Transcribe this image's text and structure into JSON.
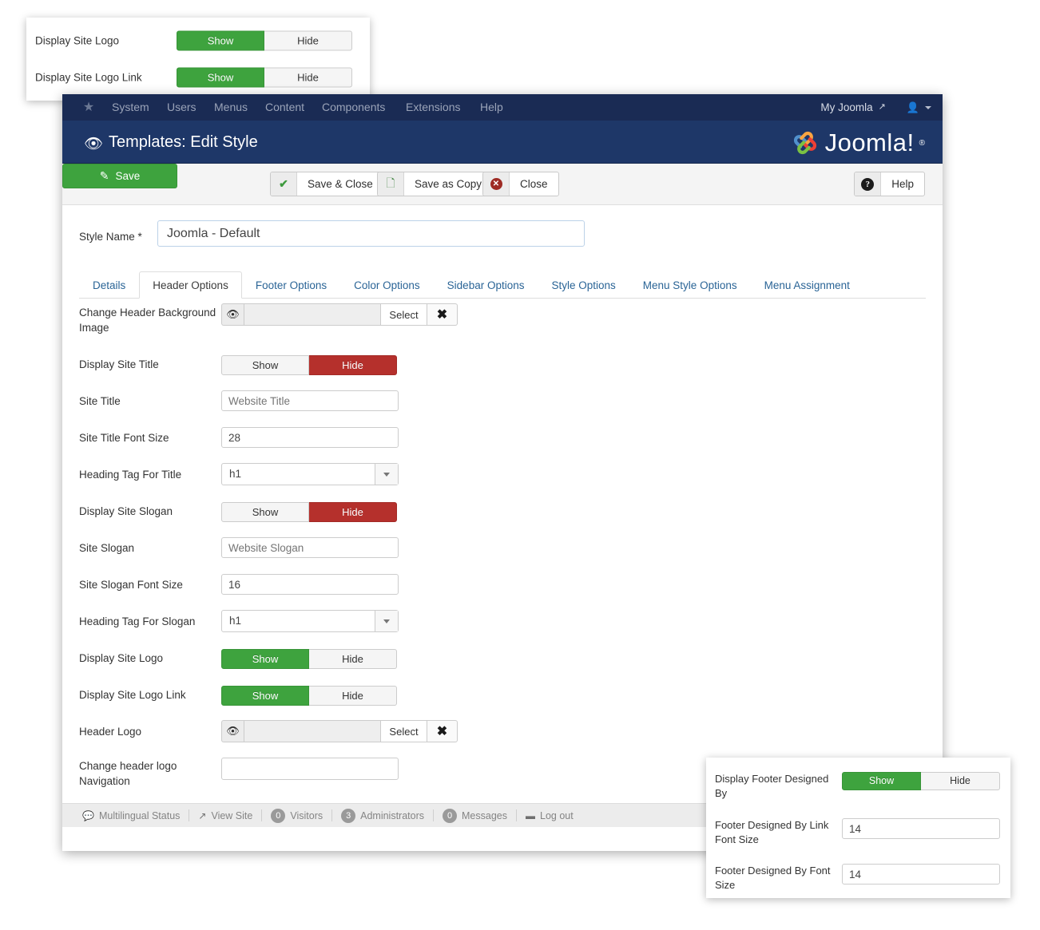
{
  "top_panel": {
    "rows": [
      {
        "label": "Display Site Logo",
        "options": [
          "Show",
          "Hide"
        ],
        "selected": "Show"
      },
      {
        "label": "Display Site Logo Link",
        "options": [
          "Show",
          "Hide"
        ],
        "selected": "Show"
      }
    ]
  },
  "topbar": {
    "brand_icon": "joomla-mark-icon",
    "menu": [
      "System",
      "Users",
      "Menus",
      "Content",
      "Components",
      "Extensions",
      "Help"
    ],
    "site_name": "My Joomla",
    "external_icon": "external-link-icon",
    "user_icon": "user-icon"
  },
  "header": {
    "icon": "eye-icon",
    "title": "Templates: Edit Style",
    "logo_text": "Joomla!",
    "logo_reg": "®"
  },
  "toolbar": {
    "save_label": "Save",
    "save_icon": "pencil-square-icon",
    "save_close_label": "Save & Close",
    "save_close_icon": "check-icon",
    "save_copy_label": "Save as Copy",
    "save_copy_icon": "copy-icon",
    "close_label": "Close",
    "close_icon": "circle-x-icon",
    "help_label": "Help",
    "help_icon": "circle-question-icon"
  },
  "form": {
    "style_name_label": "Style Name *",
    "style_name_value": "Joomla - Default"
  },
  "tabs": [
    {
      "label": "Details",
      "active": false
    },
    {
      "label": "Header Options",
      "active": true
    },
    {
      "label": "Footer Options",
      "active": false
    },
    {
      "label": "Color Options",
      "active": false
    },
    {
      "label": "Sidebar Options",
      "active": false
    },
    {
      "label": "Style Options",
      "active": false
    },
    {
      "label": "Menu Style Options",
      "active": false
    },
    {
      "label": "Menu Assignment",
      "active": false
    }
  ],
  "fields": [
    {
      "label": "Change Header Background Image",
      "type": "media",
      "value": "",
      "eye_icon": "eye-icon",
      "select_label": "Select",
      "clear_icon": "clear-x-icon"
    },
    {
      "label": "Display Site Title",
      "type": "toggle",
      "options": [
        "Show",
        "Hide"
      ],
      "selected": "Hide"
    },
    {
      "label": "Site Title",
      "type": "text",
      "value": "",
      "placeholder": "Website Title"
    },
    {
      "label": "Site Title Font Size",
      "type": "text",
      "value": "28",
      "placeholder": ""
    },
    {
      "label": "Heading Tag For Title",
      "type": "select",
      "value": "h1"
    },
    {
      "label": "Display Site Slogan",
      "type": "toggle",
      "options": [
        "Show",
        "Hide"
      ],
      "selected": "Hide"
    },
    {
      "label": "Site Slogan",
      "type": "text",
      "value": "",
      "placeholder": "Website Slogan"
    },
    {
      "label": "Site Slogan Font Size",
      "type": "text",
      "value": "16",
      "placeholder": ""
    },
    {
      "label": "Heading Tag For Slogan",
      "type": "select",
      "value": "h1"
    },
    {
      "label": "Display Site Logo",
      "type": "toggle",
      "options": [
        "Show",
        "Hide"
      ],
      "selected": "Show"
    },
    {
      "label": "Display Site Logo Link",
      "type": "toggle",
      "options": [
        "Show",
        "Hide"
      ],
      "selected": "Show"
    },
    {
      "label": "Header Logo",
      "type": "media",
      "value": "",
      "eye_icon": "eye-icon",
      "select_label": "Select",
      "clear_icon": "clear-x-icon"
    },
    {
      "label": "Change header logo Navigation",
      "type": "plain",
      "value": ""
    }
  ],
  "statusbar": {
    "items": [
      {
        "icon": "comment-icon",
        "label": "Multilingual Status",
        "badge": null
      },
      {
        "icon": "external-link-icon",
        "label": "View Site",
        "badge": null
      },
      {
        "icon": null,
        "label": "Visitors",
        "badge": "0"
      },
      {
        "icon": null,
        "label": "Administrators",
        "badge": "3"
      },
      {
        "icon": null,
        "label": "Messages",
        "badge": "0"
      },
      {
        "icon": "logout-icon",
        "label": "Log out",
        "badge": null
      }
    ]
  },
  "bottom_panel": {
    "rows": [
      {
        "label": "Display Footer Designed By",
        "type": "toggle",
        "options": [
          "Show",
          "Hide"
        ],
        "selected": "Show"
      },
      {
        "label": "Footer Designed By Link Font Size",
        "type": "text",
        "value": "14"
      },
      {
        "label": "Footer Designed By Font Size",
        "type": "text",
        "value": "14"
      }
    ]
  },
  "colors": {
    "green": "#3ea33e",
    "red": "#b5302c",
    "navy_top": "#1a2b54",
    "navy_header": "#1e3768",
    "link_blue": "#2a6496"
  }
}
